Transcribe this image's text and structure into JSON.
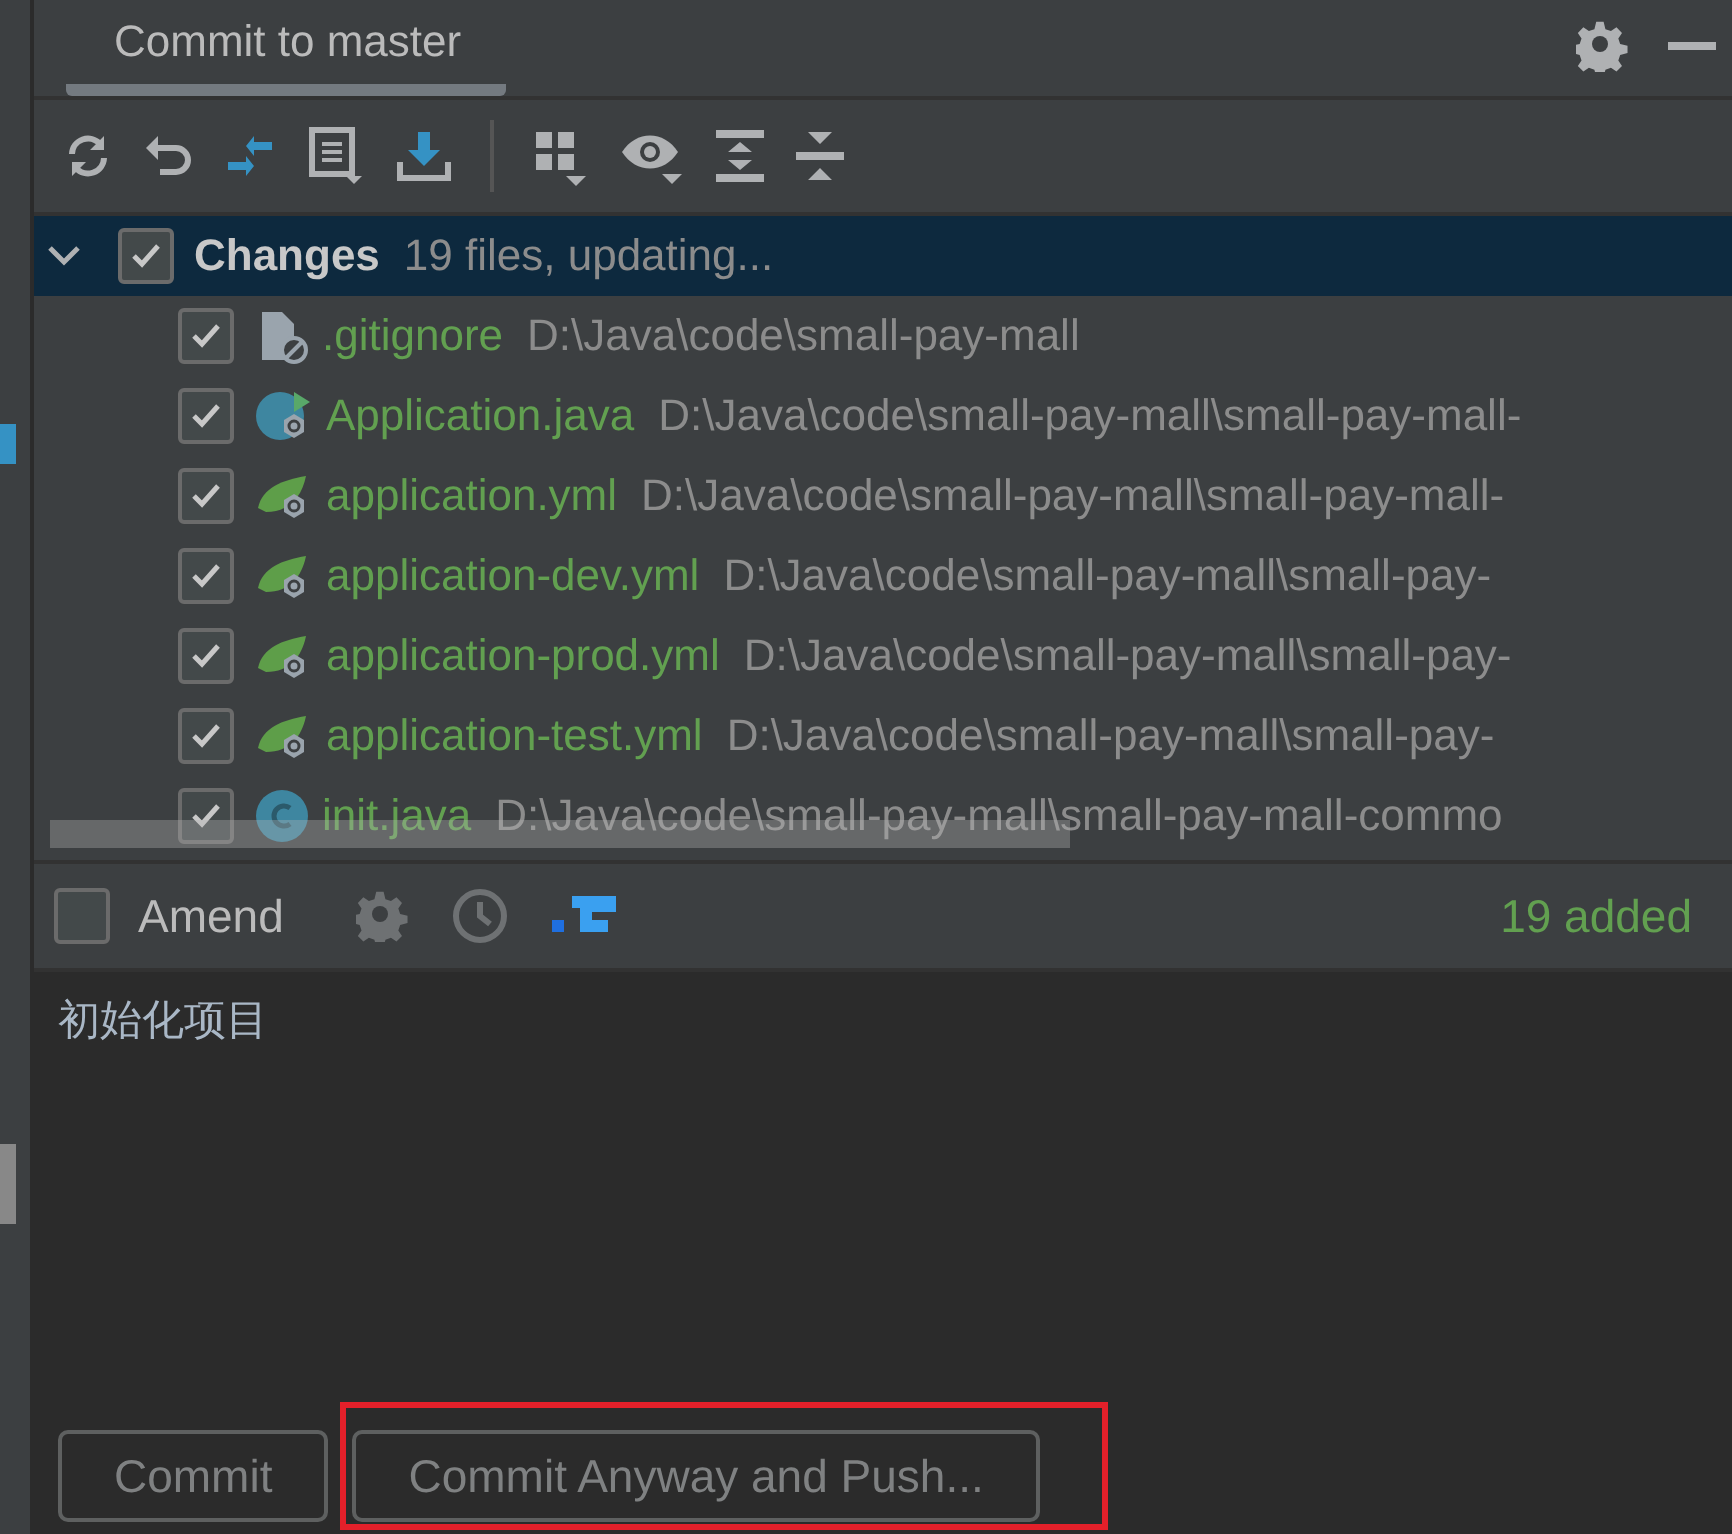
{
  "panel": {
    "title": "Commit to master"
  },
  "toolbar": [
    {
      "kind": "refresh"
    },
    {
      "kind": "rollback"
    },
    {
      "kind": "diff"
    },
    {
      "kind": "shelve"
    },
    {
      "kind": "update"
    },
    {
      "kind": "separator"
    },
    {
      "kind": "group"
    },
    {
      "kind": "view"
    },
    {
      "kind": "expand"
    },
    {
      "kind": "collapse"
    }
  ],
  "changes": {
    "label": "Changes",
    "summary": "19 files, updating...",
    "checked": true,
    "expanded": true,
    "selected": true,
    "files": [
      {
        "name": ".gitignore",
        "path": "D:\\Java\\code\\small-pay-mall",
        "kind": "ignore",
        "checked": true
      },
      {
        "name": "Application.java",
        "path": "D:\\Java\\code\\small-pay-mall\\small-pay-mall-",
        "kind": "main",
        "checked": true
      },
      {
        "name": "application.yml",
        "path": "D:\\Java\\code\\small-pay-mall\\small-pay-mall-",
        "kind": "spring",
        "checked": true
      },
      {
        "name": "application-dev.yml",
        "path": "D:\\Java\\code\\small-pay-mall\\small-pay-",
        "kind": "spring",
        "checked": true
      },
      {
        "name": "application-prod.yml",
        "path": "D:\\Java\\code\\small-pay-mall\\small-pay-",
        "kind": "spring",
        "checked": true
      },
      {
        "name": "application-test.yml",
        "path": "D:\\Java\\code\\small-pay-mall\\small-pay-",
        "kind": "spring",
        "checked": true
      },
      {
        "name": "init.java",
        "path": "D:\\Java\\code\\small-pay-mall\\small-pay-mall-commo",
        "kind": "class",
        "checked": true
      }
    ]
  },
  "amend": {
    "label": "Amend",
    "checked": false,
    "status": "19 added"
  },
  "message": {
    "value": "初始化项目"
  },
  "buttons": [
    {
      "label": "Commit",
      "highlighted": false
    },
    {
      "label": "Commit Anyway and Push...",
      "highlighted": true
    }
  ]
}
